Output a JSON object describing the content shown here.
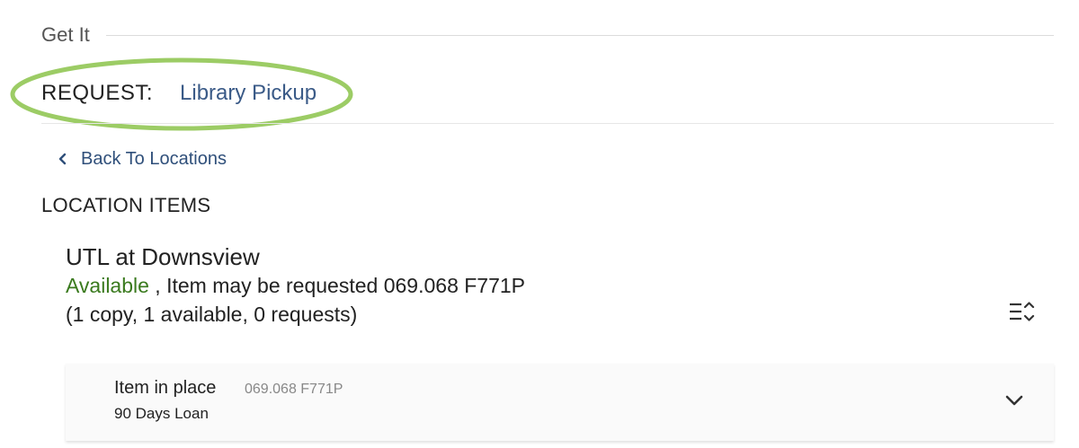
{
  "section": {
    "title": "Get It"
  },
  "request": {
    "label": "REQUEST:",
    "link": "Library Pickup"
  },
  "back_link": {
    "label": "Back To Locations"
  },
  "location_items": {
    "heading": "LOCATION ITEMS",
    "location_name": "UTL at Downsview",
    "status": "Available",
    "status_detail": " , Item may be requested 069.068 F771P",
    "copies_summary": "(1 copy, 1 available, 0 requests)"
  },
  "item": {
    "status": "Item in place",
    "call_number": "069.068 F771P",
    "policy": "90 Days Loan"
  },
  "colors": {
    "link": "#3a5a87",
    "available": "#3a7a1e",
    "highlight": "#9ccc65"
  },
  "icons": {
    "back": "chevron-left-icon",
    "sort": "sort-list-icon",
    "expand": "chevron-down-icon"
  }
}
